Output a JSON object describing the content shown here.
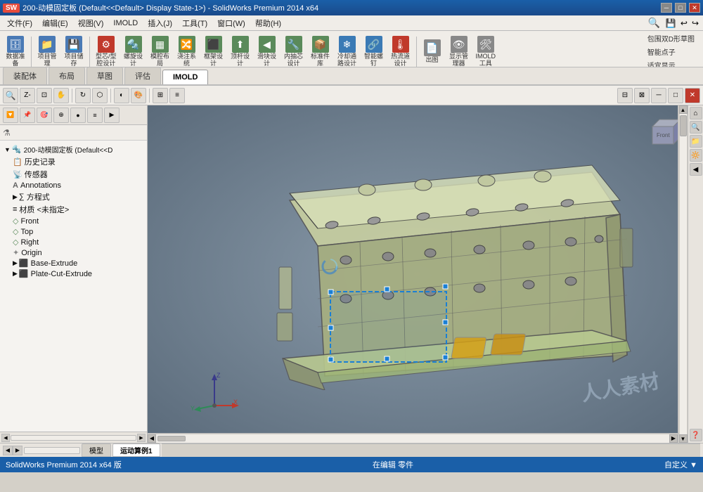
{
  "titlebar": {
    "logo": "SW",
    "title": "200-动模固定板 (Default<<Default> Display State-1>) - SolidWorks Premium 2014 x64",
    "buttons": [
      "─",
      "□",
      "✕"
    ]
  },
  "menubar": {
    "items": [
      "文件(F)",
      "编辑(E)",
      "视图(V)",
      "IMOLD",
      "插入(J)",
      "工具(T)",
      "窗口(W)",
      "帮助(H)"
    ]
  },
  "toolbar": {
    "groups": [
      {
        "label": "数据准\n备",
        "icon": "🗄"
      },
      {
        "label": "项目管\n理",
        "icon": "📁"
      },
      {
        "label": "项目储\n存",
        "icon": "💾"
      },
      {
        "label": "型芯/型\n腔设计",
        "icon": "⚙"
      },
      {
        "label": "螺旋设\n计",
        "icon": "🔩"
      },
      {
        "label": "模腔布\n局",
        "icon": "▦"
      },
      {
        "label": "浇注系\n统",
        "icon": "🔀"
      },
      {
        "label": "框架设\n计",
        "icon": "⬛"
      },
      {
        "label": "顶杆设\n计",
        "icon": "⬆"
      },
      {
        "label": "滑块设\n计",
        "icon": "◀"
      },
      {
        "label": "内抽芯\n设计",
        "icon": "🔧"
      },
      {
        "label": "标准件\n库",
        "icon": "📦"
      },
      {
        "label": "冷却通\n路设计",
        "icon": "❄"
      },
      {
        "label": "智能螺\n钉",
        "icon": "🔗"
      },
      {
        "label": "热流道\n设计",
        "icon": "🌡"
      },
      {
        "label": "出图",
        "icon": "📄"
      },
      {
        "label": "显示管\n理器",
        "icon": "👁"
      },
      {
        "label": "IMOLD\n工具",
        "icon": "🛠"
      }
    ],
    "right_items": [
      "包围双D形草图",
      "智能点子",
      "适宜显示"
    ]
  },
  "tabs": {
    "items": [
      "装配体",
      "布局",
      "草图",
      "评估",
      "IMOLD"
    ],
    "active": "IMOLD"
  },
  "toolbar2": {
    "buttons": [
      "🔍+",
      "🔍-",
      "🔍□",
      "↔",
      "🔲",
      "●",
      "◐",
      "⬡",
      "🎨",
      "⊞"
    ]
  },
  "leftpanel": {
    "toolbar_icons": [
      "🔽",
      "📌",
      "🎯",
      "⊕",
      "🔘",
      "≡",
      "▶"
    ],
    "filter_icon": "⚗",
    "tree": {
      "root": "200-动模固定板 (Default<<D",
      "items": [
        {
          "label": "历史记录",
          "icon": "📋",
          "indent": 1,
          "expandable": false
        },
        {
          "label": "传感器",
          "icon": "📡",
          "indent": 1,
          "expandable": false
        },
        {
          "label": "Annotations",
          "icon": "A",
          "indent": 1,
          "expandable": false
        },
        {
          "label": "方程式",
          "icon": "∑",
          "indent": 1,
          "expandable": false
        },
        {
          "label": "材质 <未指定>",
          "icon": "≡",
          "indent": 1,
          "expandable": false
        },
        {
          "label": "Front",
          "icon": "◇",
          "indent": 1,
          "expandable": false
        },
        {
          "label": "Top",
          "icon": "◇",
          "indent": 1,
          "expandable": false
        },
        {
          "label": "Right",
          "icon": "◇",
          "indent": 1,
          "expandable": false
        },
        {
          "label": "Origin",
          "icon": "✦",
          "indent": 1,
          "expandable": false
        },
        {
          "label": "Base-Extrude",
          "icon": "⬛",
          "indent": 1,
          "expandable": true
        },
        {
          "label": "Plate-Cut-Extrude",
          "icon": "⬛",
          "indent": 1,
          "expandable": true
        }
      ]
    }
  },
  "viewport": {
    "bg_color": "#7a8a9a"
  },
  "rightpanel": {
    "buttons": [
      "⌂",
      "🔍",
      "📁",
      "🔆",
      "◀",
      "❓"
    ]
  },
  "bottomtabs": {
    "items": [
      "模型",
      "运动算例1"
    ],
    "active": "运动算例1"
  },
  "statusbar": {
    "left": "SolidWorks Premium 2014 x64 版",
    "middle": "在编辑 零件",
    "right": "自定义 ▼"
  }
}
